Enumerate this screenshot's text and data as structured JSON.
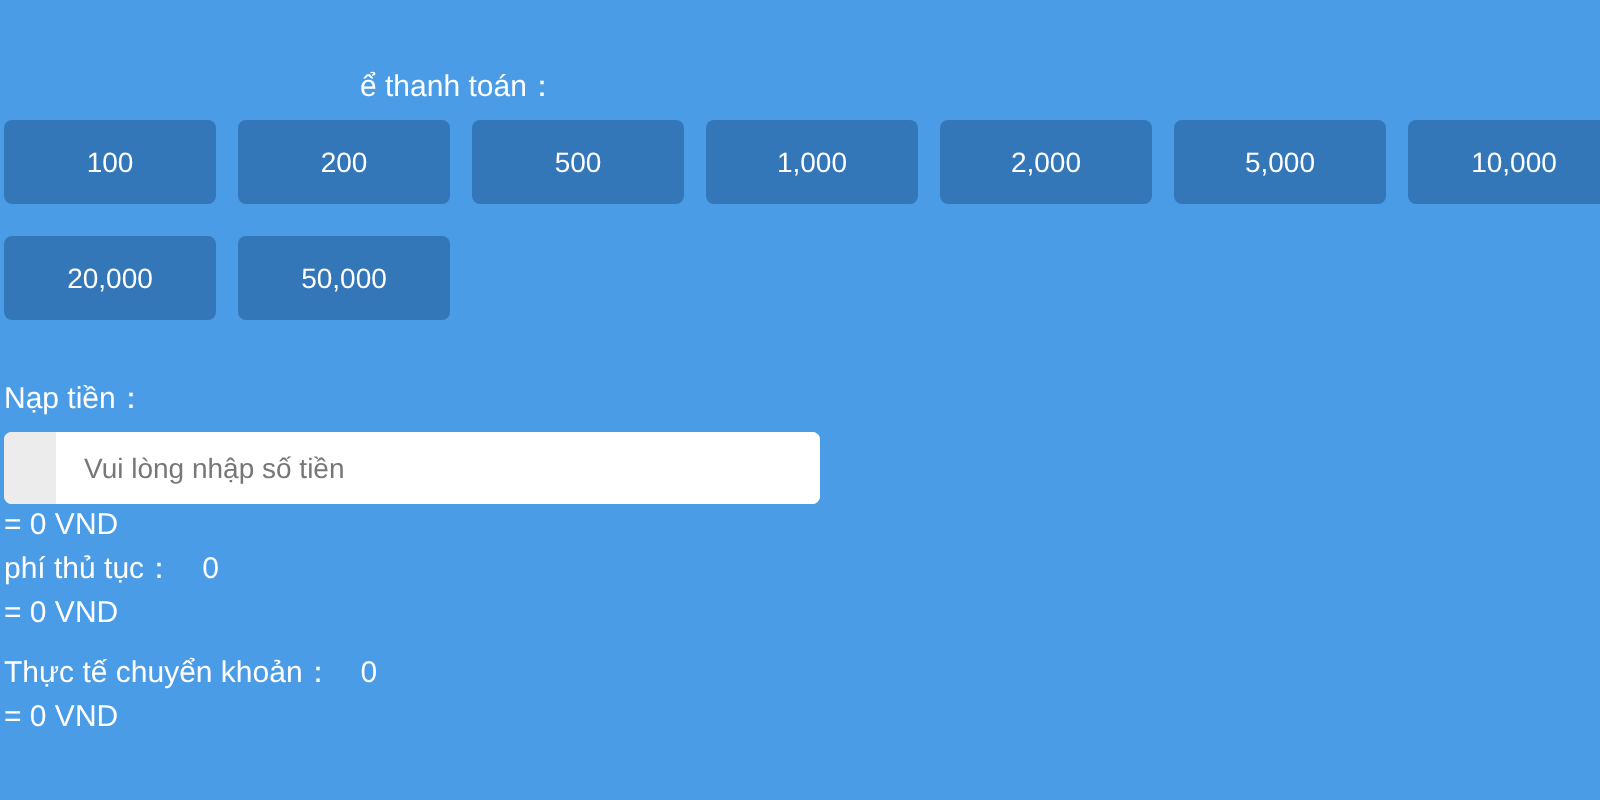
{
  "amounts_label": "ể thanh toán：",
  "amounts": [
    "100",
    "200",
    "500",
    "1,000",
    "2,000",
    "5,000",
    "10,000",
    "20,000",
    "50,000"
  ],
  "deposit": {
    "label": "Nạp tiền：",
    "placeholder": "Vui lòng nhập số tiền",
    "converted": "= 0 VND"
  },
  "fee": {
    "label": "phí thủ tục：",
    "value": "0",
    "converted": "= 0 VND"
  },
  "actual": {
    "label": "Thực tế chuyển khoản：",
    "value": "0",
    "converted": "= 0 VND"
  }
}
